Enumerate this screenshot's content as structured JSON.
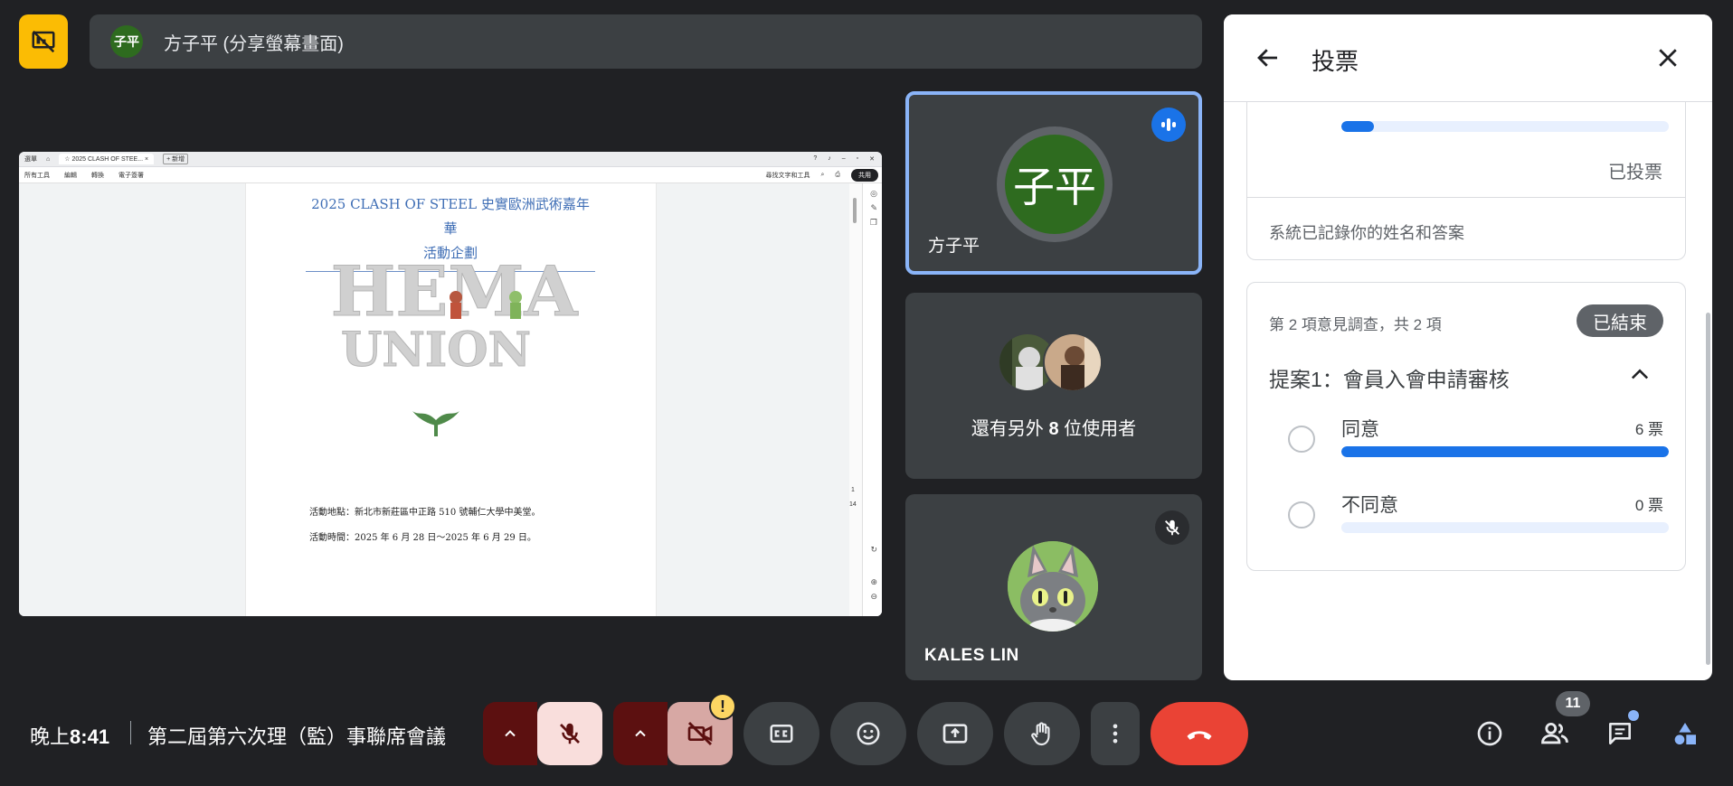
{
  "presenter": {
    "avatar_initials": "子平",
    "label": "方子平 (分享螢幕畫面)"
  },
  "shared_screen": {
    "tab_menu": "選單",
    "tab_title": "2025 CLASH OF STEE...",
    "tab_new": "新增",
    "menu_items": [
      "所有工具",
      "編輯",
      "轉換",
      "電子簽署"
    ],
    "find_text": "尋找文字和工具",
    "share_button": "共用",
    "doc_title_line1": "2025 CLASH OF STEEL 史實歐洲武術嘉年華",
    "doc_title_line2": "活動企劃",
    "logo_line1": "HEMA",
    "logo_line2": "UNION",
    "location_line": "活動地點：新北市新莊區中正路 510 號輔仁大學中美堂。",
    "time_line": "活動時間：2025 年 6 月 28 日～2025 年 6 月 29 日。",
    "page_current": "1",
    "page_total": "14"
  },
  "tiles": {
    "speaker": {
      "initials": "子平",
      "name": "方子平"
    },
    "others": {
      "prefix": "還有另外 ",
      "count": "8",
      "suffix": " 位使用者"
    },
    "kales": {
      "name": "KALES LIN"
    }
  },
  "poll_panel": {
    "title": "投票",
    "voted_label": "已投票",
    "recorded_notice": "系統已記錄你的姓名和答案",
    "previous_poll_fill": 0.1,
    "poll": {
      "counter": "第 2 項意見調查，共 2 項",
      "status": "已結束",
      "question": "提案1：會員入會申請審核",
      "options": [
        {
          "label": "同意",
          "votes": "6 票",
          "fill": 1.0
        },
        {
          "label": "不同意",
          "votes": "0 票",
          "fill": 0.0
        }
      ]
    }
  },
  "bottom_bar": {
    "time_prefix": "晚上",
    "time_value": "8:41",
    "meeting_title": "第二屆第六次理（監）事聯席會議",
    "camera_alert": "!",
    "people_count": "11"
  },
  "colors": {
    "accent_blue": "#1a73e8",
    "hangup_red": "#ea4335",
    "present_yellow": "#fbbc04",
    "avatar_green": "#2e6b1f"
  }
}
